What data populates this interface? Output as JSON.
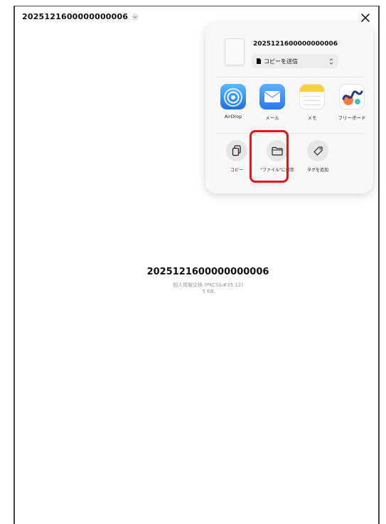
{
  "header": {
    "title": "2025121600000000006"
  },
  "share_sheet": {
    "doc_title": "2025121600000000006",
    "send_mode": "コピーを送信",
    "apps": [
      {
        "label": "AirDrop",
        "icon": "airdrop-icon"
      },
      {
        "label": "メール",
        "icon": "mail-icon"
      },
      {
        "label": "メモ",
        "icon": "notes-icon"
      },
      {
        "label": "フリーボード",
        "icon": "freeform-icon"
      }
    ],
    "actions": [
      {
        "label": "コピー",
        "icon": "copy-icon"
      },
      {
        "label": "\"ファイル\"に保存",
        "icon": "folder-icon"
      },
      {
        "label": "タグを追加",
        "icon": "tag-icon"
      }
    ]
  },
  "file": {
    "name": "2025121600000000006",
    "type": "個人情報交換 (PKCS&#35;12)",
    "size": "5 KB"
  },
  "colors": {
    "highlight": "#ee1111",
    "mail": "#3a8dff",
    "airdrop": "#2f8be6"
  }
}
